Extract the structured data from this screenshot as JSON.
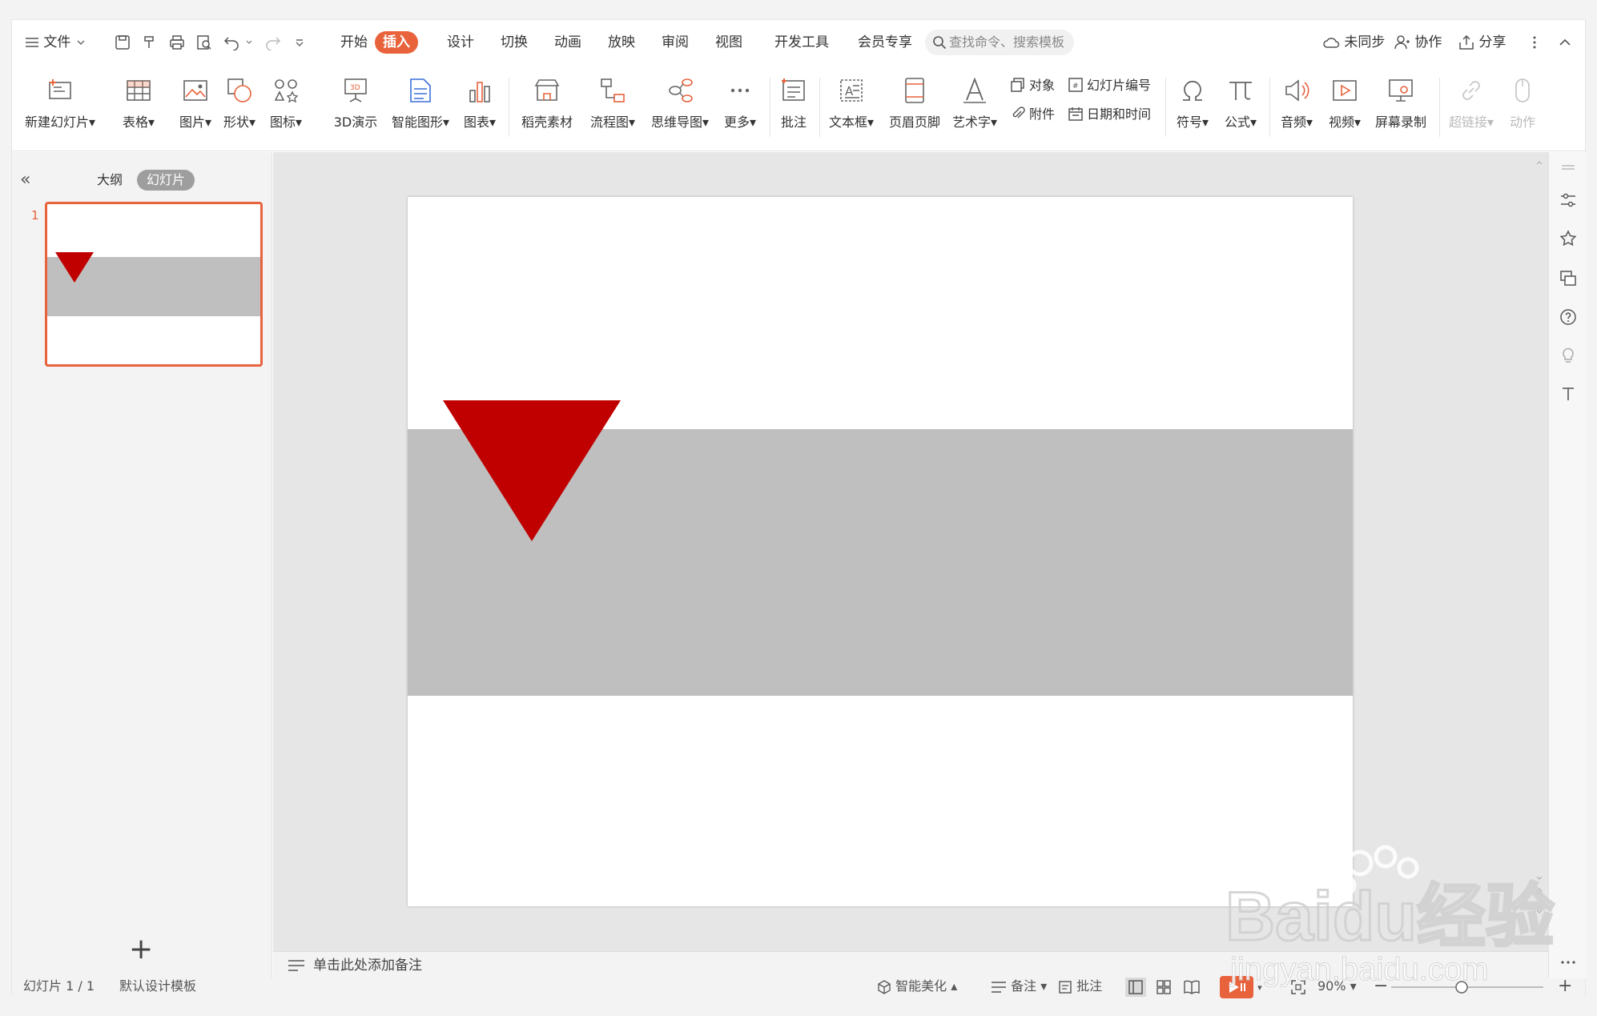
{
  "menubar": {
    "file_label": "文件",
    "tabs": [
      {
        "label": "开始",
        "active": false
      },
      {
        "label": "插入",
        "active": true
      },
      {
        "label": "设计",
        "active": false
      },
      {
        "label": "切换",
        "active": false
      },
      {
        "label": "动画",
        "active": false
      },
      {
        "label": "放映",
        "active": false
      },
      {
        "label": "审阅",
        "active": false
      },
      {
        "label": "视图",
        "active": false
      },
      {
        "label": "开发工具",
        "active": false
      },
      {
        "label": "会员专享",
        "active": false
      }
    ],
    "search_placeholder": "查找命令、搜索模板",
    "sync_label": "未同步",
    "collab_label": "协作",
    "share_label": "分享"
  },
  "ribbon": {
    "new_slide": "新建幻灯片",
    "table": "表格",
    "picture": "图片",
    "shape": "形状",
    "icon": "图标",
    "3d": "3D演示",
    "smartart": "智能图形",
    "chart": "图表",
    "material": "稻壳素材",
    "flowchart": "流程图",
    "mindmap": "思维导图",
    "more": "更多",
    "comment": "批注",
    "textbox": "文本框",
    "header_footer": "页眉页脚",
    "wordart": "艺术字",
    "object": "对象",
    "attachment": "附件",
    "slide_number": "幻灯片编号",
    "datetime": "日期和时间",
    "symbol": "符号",
    "formula": "公式",
    "audio": "音频",
    "video": "视频",
    "screen_record": "屏幕录制",
    "hyperlink": "超链接",
    "action": "动作"
  },
  "left_panel": {
    "outline_tab": "大纲",
    "slides_tab": "幻灯片",
    "slide_number": "1"
  },
  "notes_placeholder": "单击此处添加备注",
  "statusbar": {
    "slide_info": "幻灯片 1 / 1",
    "template": "默认设计模板",
    "beautify": "智能美化",
    "notes": "备注",
    "comment": "批注",
    "zoom": "90%"
  },
  "watermark": {
    "brand": "Baidu经验",
    "url": "jingyan.baidu.com"
  },
  "colors": {
    "accent": "#e8623b",
    "triangle": "#c00000",
    "band": "#bfbfbf"
  }
}
